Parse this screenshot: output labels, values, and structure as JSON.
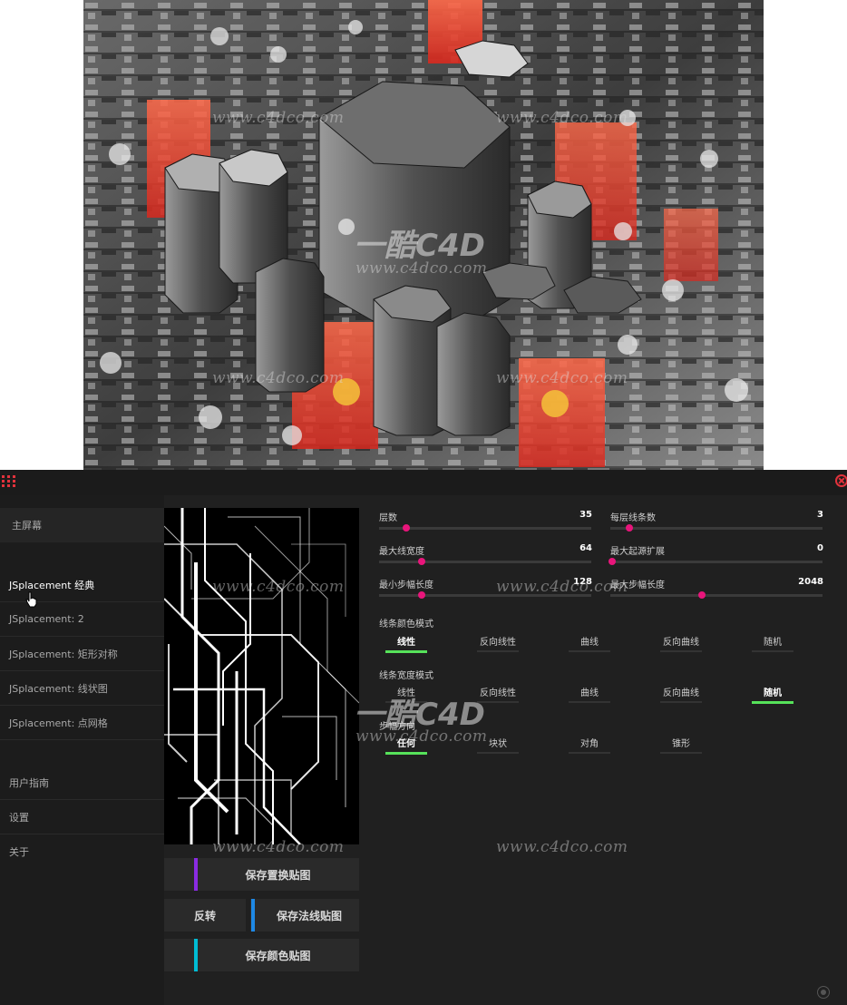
{
  "sidebar": {
    "home": "主屏幕",
    "presets": [
      "JSplacement 经典",
      "JSplacement: 2",
      "JSplacement: 矩形对称",
      "JSplacement: 线状图",
      "JSplacement: 点网格"
    ],
    "active_preset": 0,
    "footer": [
      "用户指南",
      "设置",
      "关于"
    ]
  },
  "buttons": {
    "save_displacement": "保存置换贴图",
    "invert": "反转",
    "save_normal": "保存法线贴图",
    "save_color": "保存颜色贴图"
  },
  "sliders": [
    {
      "label": "层数",
      "value": "35",
      "fraction": 0.13
    },
    {
      "label": "每层线条数",
      "value": "3",
      "fraction": 0.09
    },
    {
      "label": "最大线宽度",
      "value": "64",
      "fraction": 0.2
    },
    {
      "label": "最大起源扩展",
      "value": "0",
      "fraction": 0.01
    },
    {
      "label": "最小步幅长度",
      "value": "128",
      "fraction": 0.2
    },
    {
      "label": "最大步幅长度",
      "value": "2048",
      "fraction": 0.43
    }
  ],
  "line_color_mode": {
    "label": "线条颜色模式",
    "options": [
      "线性",
      "反向线性",
      "曲线",
      "反向曲线",
      "随机"
    ],
    "selected": 0
  },
  "line_width_mode": {
    "label": "线条宽度模式",
    "options": [
      "线性",
      "反向线性",
      "曲线",
      "反向曲线",
      "随机"
    ],
    "selected": 4
  },
  "step_direction": {
    "label": "步幅方向",
    "options": [
      "任何",
      "块状",
      "对角",
      "锥形"
    ],
    "selected": 0
  },
  "watermark": {
    "url": "www.c4dco.com",
    "logo": "一酷C4D"
  },
  "colors": {
    "accent_pink": "#e8157b",
    "accent_green": "#56e25a",
    "accent_purple": "#8a2be2",
    "accent_blue": "#1e88e5",
    "accent_cyan": "#00bcd4",
    "close_red": "#e2323c"
  }
}
